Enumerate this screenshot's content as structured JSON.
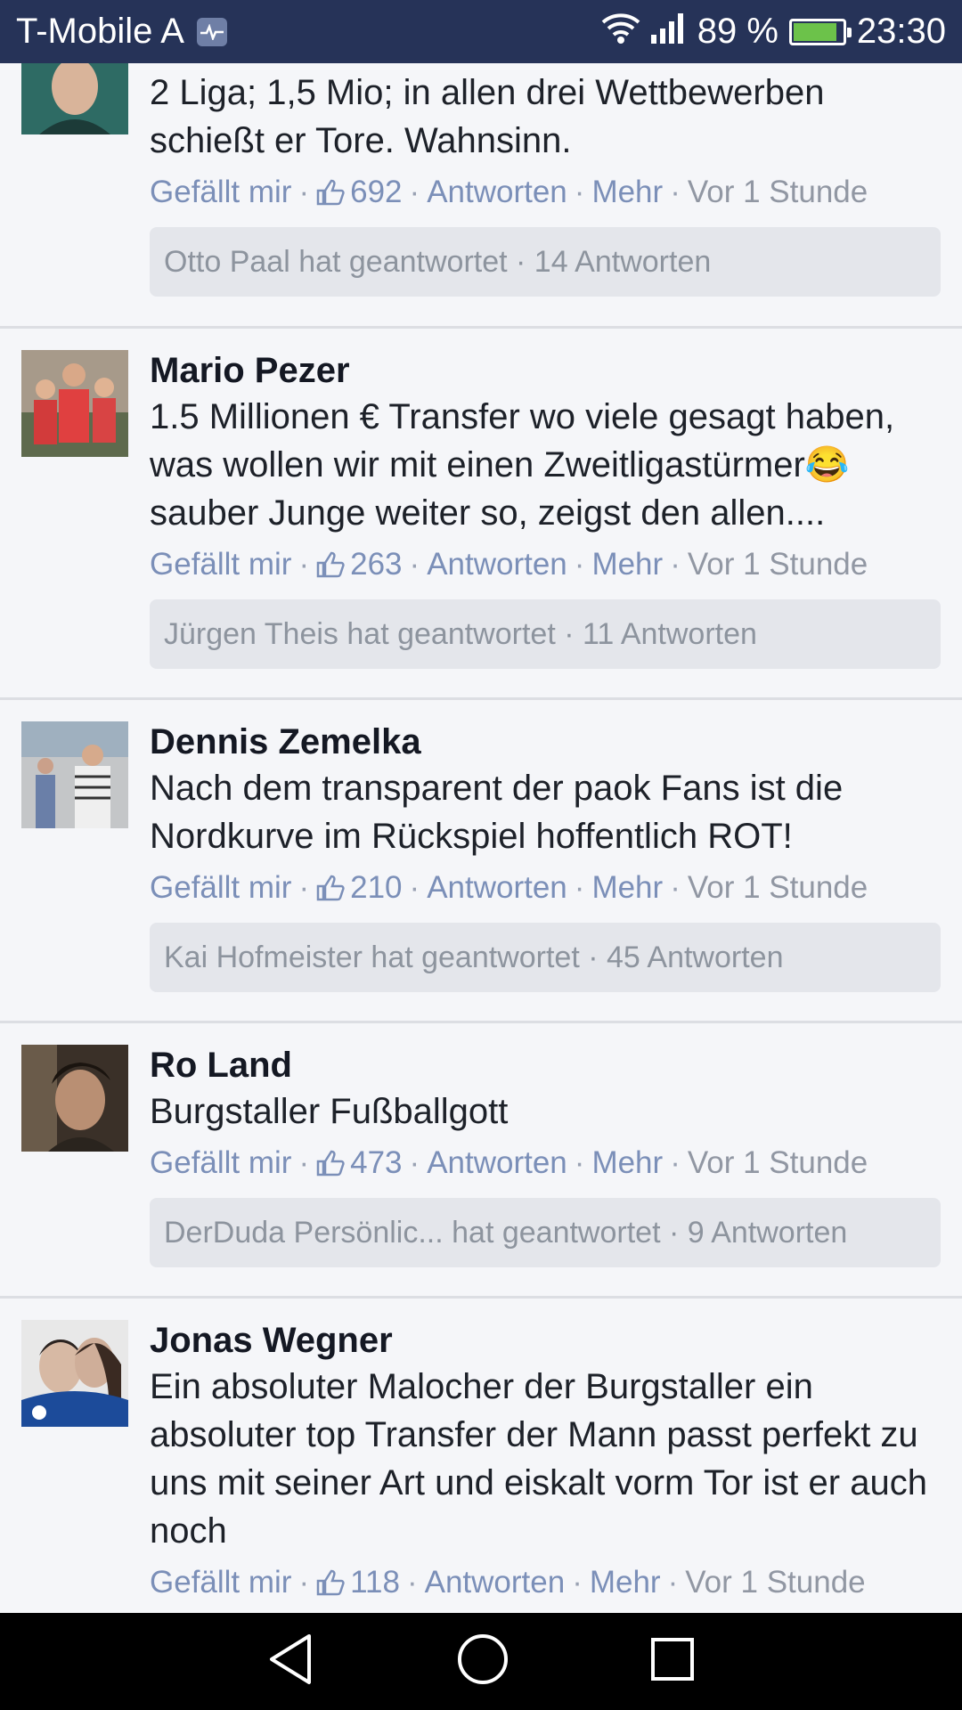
{
  "status_bar": {
    "carrier": "T-Mobile A",
    "signal_percent": "89 %",
    "time": "23:30",
    "battery_level": 0.89,
    "icons": [
      "heart-rate-icon",
      "wifi-icon",
      "signal-icon",
      "battery-icon"
    ]
  },
  "comments": [
    {
      "author": "",
      "text": "2 Liga; 1,5 Mio; in allen drei Wettbewerben schießt er Tore. Wahnsinn.",
      "like_label": "Gefällt mir",
      "like_count": "692",
      "reply_label": "Antworten",
      "more_label": "Mehr",
      "time": "Vor 1 Stunde",
      "replies_text": "Otto Paal hat geantwortet · 14 Antworten"
    },
    {
      "author": "Mario Pezer",
      "text": "1.5 Millionen € Transfer wo viele gesagt haben, was wollen wir mit einen Zweitligastürmer😂 sauber Junge weiter so, zeigst den allen....",
      "like_label": "Gefällt mir",
      "like_count": "263",
      "reply_label": "Antworten",
      "more_label": "Mehr",
      "time": "Vor 1 Stunde",
      "replies_text": "Jürgen Theis hat geantwortet · 11 Antworten"
    },
    {
      "author": "Dennis Zemelka",
      "text": "Nach dem transparent der paok Fans ist die Nordkurve im Rückspiel hoffentlich ROT!",
      "like_label": "Gefällt mir",
      "like_count": "210",
      "reply_label": "Antworten",
      "more_label": "Mehr",
      "time": "Vor 1 Stunde",
      "replies_text": "Kai Hofmeister hat geantwortet · 45 Antworten"
    },
    {
      "author": "Ro Land",
      "text": "Burgstaller Fußballgott",
      "like_label": "Gefällt mir",
      "like_count": "473",
      "reply_label": "Antworten",
      "more_label": "Mehr",
      "time": "Vor 1 Stunde",
      "replies_text": "DerDuda Persönlic... hat geantwortet · 9 Antworten"
    },
    {
      "author": "Jonas Wegner",
      "text": "Ein absoluter Malocher der Burgstaller ein absoluter top Transfer der Mann passt perfekt zu uns mit seiner Art und eiskalt vorm Tor ist er auch noch",
      "like_label": "Gefällt mir",
      "like_count": "118",
      "reply_label": "Antworten",
      "more_label": "Mehr",
      "time": "Vor 1 Stunde",
      "replies_text": ""
    }
  ],
  "nav": {
    "icons": [
      "back-icon",
      "home-icon",
      "recents-icon"
    ]
  }
}
